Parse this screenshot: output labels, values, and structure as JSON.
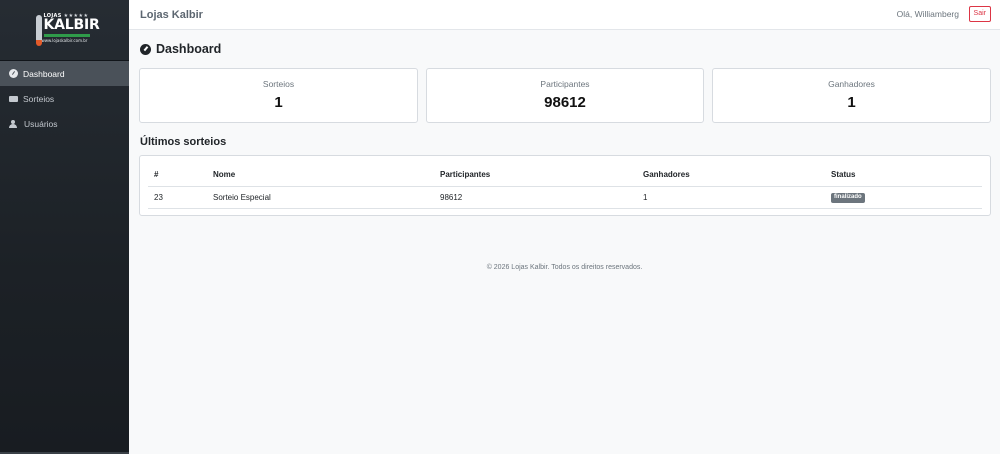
{
  "sidebar": {
    "logo": {
      "top_line": "LOJAS",
      "stars": "★★★★★",
      "brand": "KALBIR",
      "site": "www.lojaskalbir.com.br"
    },
    "items": [
      {
        "label": "Dashboard",
        "icon": "gauge-icon",
        "active": true
      },
      {
        "label": "Sorteios",
        "icon": "ticket-icon",
        "active": false
      },
      {
        "label": "Usuários",
        "icon": "users-icon",
        "active": false
      }
    ]
  },
  "header": {
    "brand": "Lojas Kalbir",
    "greeting": "Olá, Williamberg",
    "logout_label": "Sair"
  },
  "main": {
    "page_title": "Dashboard",
    "cards": [
      {
        "label": "Sorteios",
        "value": "1"
      },
      {
        "label": "Participantes",
        "value": "98612"
      },
      {
        "label": "Ganhadores",
        "value": "1"
      }
    ],
    "recent_title": "Últimos sorteios",
    "table": {
      "headers": [
        "#",
        "Nome",
        "Participantes",
        "Ganhadores",
        "Status"
      ],
      "rows": [
        {
          "id": "23",
          "nome": "Sorteio Especial",
          "participantes": "98612",
          "ganhadores": "1",
          "status": "finalizado"
        }
      ]
    }
  },
  "footer": {
    "text": "© 2026 Lojas Kalbir. Todos os direitos reservados."
  },
  "colors": {
    "sidebar_bg": "#1c2126",
    "active_item": "#4a5159",
    "danger": "#dc3545",
    "badge": "#6c757d"
  }
}
